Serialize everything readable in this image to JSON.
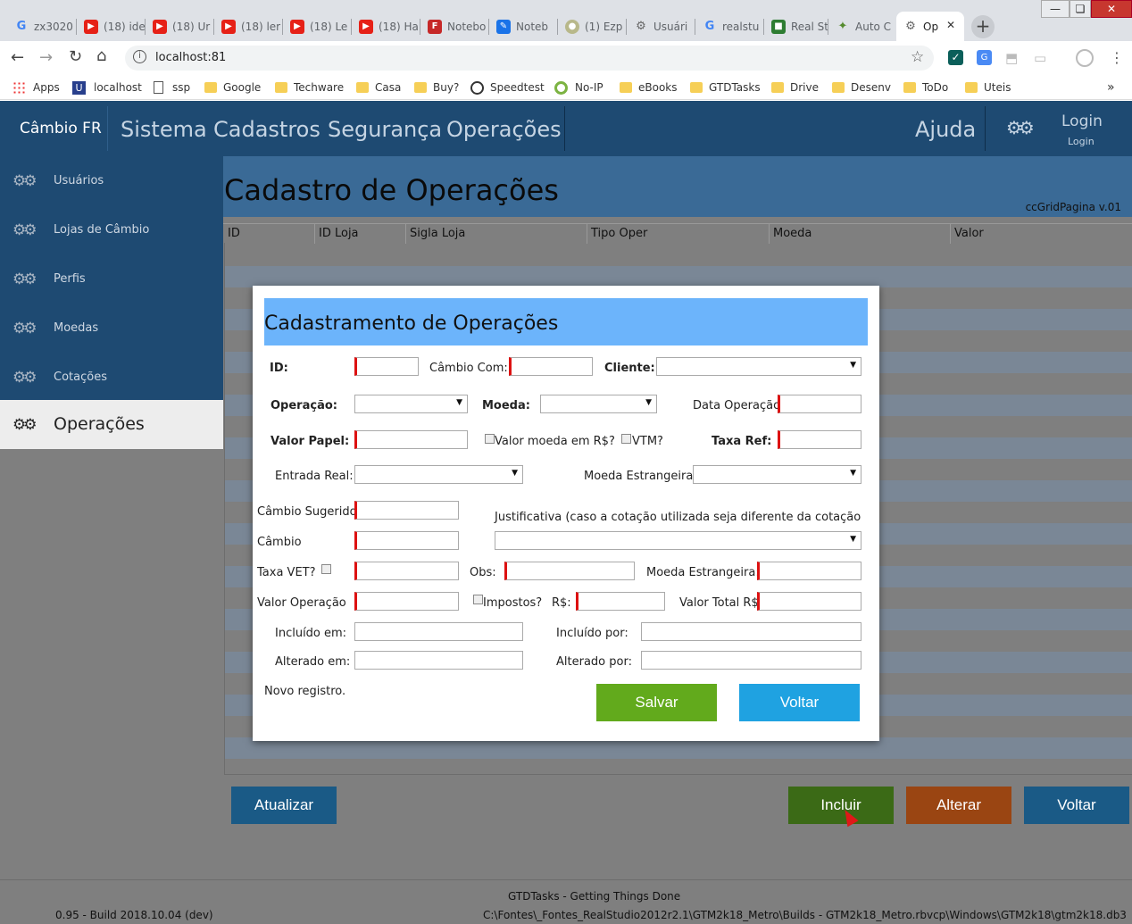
{
  "browser": {
    "tabs": [
      {
        "label": "zx3020",
        "icon": "google-icon",
        "color": "#4285f4"
      },
      {
        "label": "(18) ide",
        "icon": "youtube-icon",
        "color": "#e62117"
      },
      {
        "label": "(18) Ur",
        "icon": "youtube-icon",
        "color": "#e62117"
      },
      {
        "label": "(18) ler",
        "icon": "youtube-icon",
        "color": "#e62117"
      },
      {
        "label": "(18) Le",
        "icon": "youtube-icon",
        "color": "#e62117"
      },
      {
        "label": "(18) Ha",
        "icon": "youtube-icon",
        "color": "#e62117"
      },
      {
        "label": "Notebo",
        "icon": "notebook-icon",
        "color": "#c62828"
      },
      {
        "label": "Noteb",
        "icon": "notebook-icon",
        "color": "#1a73e8"
      },
      {
        "label": "(1) Ezp",
        "icon": "ezp-icon",
        "color": "#9e9e6e"
      },
      {
        "label": "Usuári",
        "icon": "gear-icon",
        "color": "#666"
      },
      {
        "label": "realstu",
        "icon": "google-icon",
        "color": "#4285f4"
      },
      {
        "label": "Real St",
        "icon": "cube-icon",
        "color": "#2e7d32"
      },
      {
        "label": "Auto C",
        "icon": "bird-icon",
        "color": "#558b2f"
      },
      {
        "label": "Op",
        "icon": "gear-icon",
        "color": "#666"
      }
    ],
    "new_tab": "+",
    "window_buttons": [
      "—",
      "❏",
      "✕"
    ],
    "address": "localhost:81",
    "bookmarks": [
      {
        "label": "Apps",
        "icon": "apps-icon"
      },
      {
        "label": "localhost",
        "icon": "u-icon"
      },
      {
        "label": "ssp",
        "icon": "page-icon"
      },
      {
        "label": "Google",
        "icon": "folder-icon"
      },
      {
        "label": "Techware",
        "icon": "folder-icon"
      },
      {
        "label": "Casa",
        "icon": "folder-icon"
      },
      {
        "label": "Buy?",
        "icon": "folder-icon"
      },
      {
        "label": "Speedtest",
        "icon": "speedometer-icon"
      },
      {
        "label": "No-IP",
        "icon": "noip-icon"
      },
      {
        "label": "eBooks",
        "icon": "folder-icon"
      },
      {
        "label": "GTDTasks",
        "icon": "folder-icon"
      },
      {
        "label": "Drive",
        "icon": "folder-icon"
      },
      {
        "label": "Desenv",
        "icon": "folder-icon"
      },
      {
        "label": "ToDo",
        "icon": "folder-icon"
      },
      {
        "label": "Uteis",
        "icon": "folder-icon"
      }
    ],
    "more_bookmarks": "»"
  },
  "nav": {
    "brand": "Câmbio FR",
    "menu": [
      "Sistema",
      "Cadastros",
      "Segurança",
      "Operações"
    ],
    "help": "Ajuda",
    "login": "Login",
    "login_sub": "Login"
  },
  "sidebar": {
    "items": [
      {
        "label": "Usuários",
        "selected": false
      },
      {
        "label": "Lojas de Câmbio",
        "selected": false
      },
      {
        "label": "Perfis",
        "selected": false
      },
      {
        "label": "Moedas",
        "selected": false
      },
      {
        "label": "Cotações",
        "selected": false
      },
      {
        "label": "Operações",
        "selected": true
      }
    ]
  },
  "page": {
    "title": "Cadastro de Operações",
    "version": "ccGridPagina v.01"
  },
  "grid": {
    "columns": [
      "ID",
      "ID Loja",
      "Sigla Loja",
      "Tipo Oper",
      "Moeda",
      "Valor"
    ]
  },
  "actions": {
    "atualizar": "Atualizar",
    "incluir": "Incluir",
    "alterar": "Alterar",
    "voltar": "Voltar",
    "colors": {
      "atualizar": "#1a5a86",
      "incluir": "#3b6a16",
      "alterar": "#9a4512",
      "voltar": "#1a5a86"
    }
  },
  "footer": {
    "title": "GTDTasks - Getting Things Done",
    "build": "0.95 - Build 2018.10.04 (dev)",
    "path": "C:\\Fontes\\_Fontes_RealStudio2012r2.1\\GTM2k18_Metro\\Builds - GTM2k18_Metro.rbvcp\\Windows\\GTM2k18\\gtm2k18.db3"
  },
  "modal": {
    "title": "Cadastramento de Operações",
    "labels": {
      "id": "ID:",
      "cambio_com": "Câmbio Com:",
      "cliente": "Cliente:",
      "operacao": "Operação:",
      "moeda": "Moeda:",
      "data_operacao": "Data Operação:",
      "valor_papel": "Valor Papel:",
      "valor_moeda_rs": "Valor moeda em R$?",
      "vtm": "VTM?",
      "taxa_ref": "Taxa Ref:",
      "entrada_real": "Entrada Real:",
      "moeda_estrangeira": "Moeda Estrangeira:",
      "cambio_sugerido": "Câmbio Sugerido:",
      "justificativa": "Justificativa (caso a cotação utilizada seja diferente da cotação",
      "cambio": "Câmbio",
      "taxa_vet": "Taxa VET?",
      "obs": "Obs:",
      "moeda_estrangeira2": "Moeda Estrangeira:",
      "valor_operacao": "Valor Operação",
      "impostos": "Impostos?",
      "rs": "R$:",
      "valor_total": "Valor Total R$:",
      "incluido_em": "Incluído em:",
      "incluido_por": "Incluído por:",
      "alterado_em": "Alterado em:",
      "alterado_por": "Alterado por:"
    },
    "status": "Novo registro.",
    "save": "Salvar",
    "back": "Voltar",
    "colors": {
      "header": "#6cb4fb",
      "save": "#62aa1c",
      "back": "#1fa2e1",
      "required": "#dd1111"
    }
  }
}
